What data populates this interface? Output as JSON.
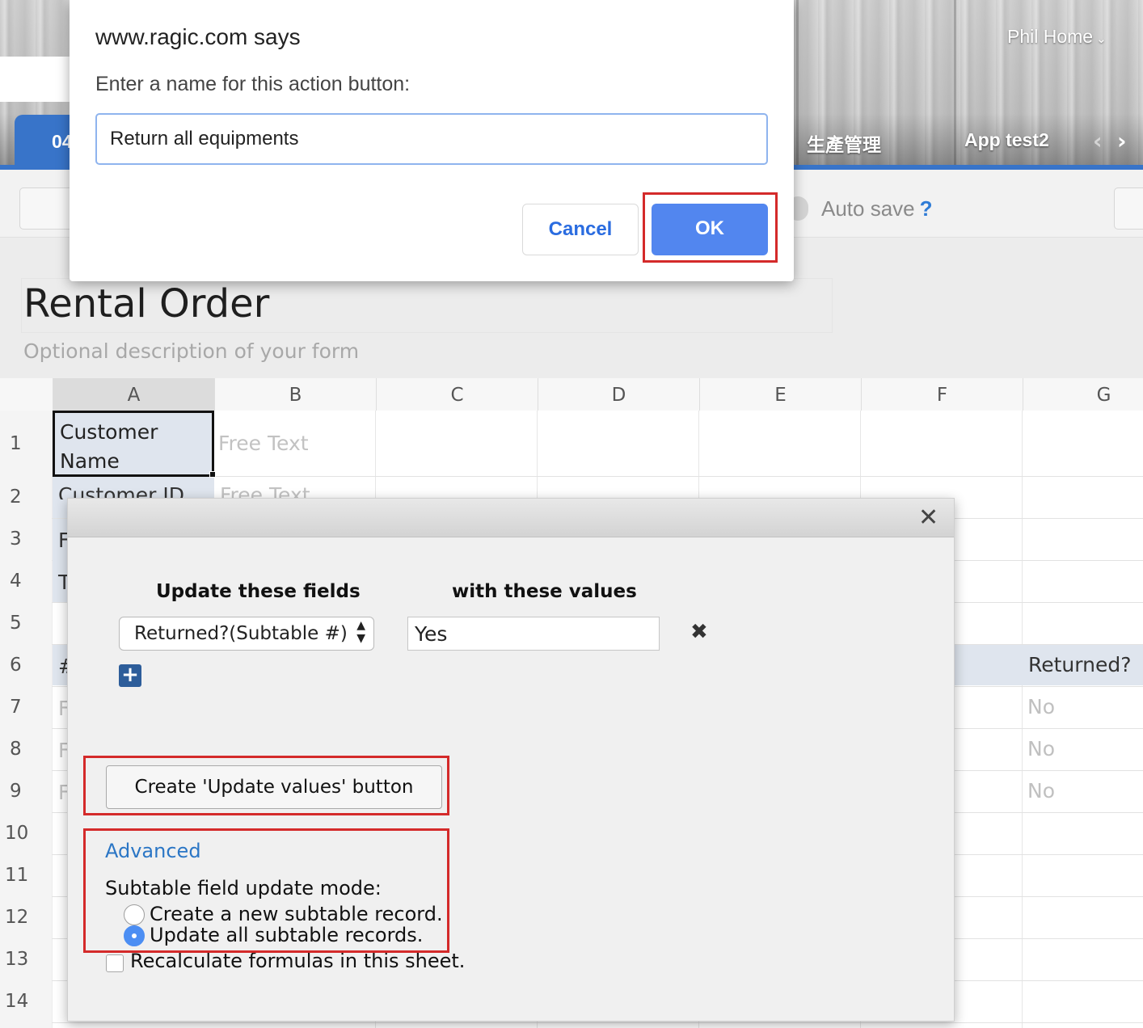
{
  "header": {
    "user_menu": "Phil Home",
    "tabs": [
      {
        "label": "04",
        "active": true
      },
      {
        "label": "生產管理",
        "active": false
      },
      {
        "label": "App test2",
        "active": false
      }
    ]
  },
  "toolbar": {
    "autosave_label": "Auto save",
    "autosave_help": "?"
  },
  "form": {
    "title": "Rental Order",
    "description": "Optional description of your form"
  },
  "sheet": {
    "columns": [
      "A",
      "B",
      "C",
      "D",
      "E",
      "F",
      "G"
    ],
    "rows": [
      "1",
      "2",
      "3",
      "4",
      "5",
      "6",
      "7",
      "8",
      "9",
      "10",
      "11",
      "12",
      "13",
      "14"
    ],
    "a1_value": "Customer Name",
    "b1_value": "Free Text",
    "a2_value": "Customer ID",
    "b2_value": "Free Text",
    "g6_value": "Returned?",
    "g7_value": "No",
    "g8_value": "No",
    "g9_value": "No",
    "left_fragments": {
      "r3": "F",
      "r4": "T",
      "r6": "#",
      "r7": "F",
      "r8": "F",
      "r9": "F"
    }
  },
  "prompt": {
    "title": "www.ragic.com says",
    "message": "Enter a name for this action button:",
    "input_value": "Return all equipments",
    "cancel_label": "Cancel",
    "ok_label": "OK"
  },
  "dialog": {
    "close_glyph": "✕",
    "header_fields": "Update these fields",
    "header_values": "with these values",
    "field_select": "Returned?(Subtable #)",
    "value_input": "Yes",
    "remove_glyph": "✖",
    "add_glyph": "+",
    "create_button": "Create 'Update values' button",
    "advanced_link": "Advanced",
    "mode_label": "Subtable field update mode:",
    "mode_options": [
      {
        "label": "Create a new subtable record.",
        "selected": false
      },
      {
        "label": "Update all subtable records.",
        "selected": true
      }
    ],
    "recalc_label": "Recalculate formulas in this sheet.",
    "recalc_checked": false
  },
  "colors": {
    "accent_blue": "#3874c9",
    "ok_button": "#5286ef",
    "highlight_red": "#d42a2a",
    "link_blue": "#2b76c5"
  }
}
